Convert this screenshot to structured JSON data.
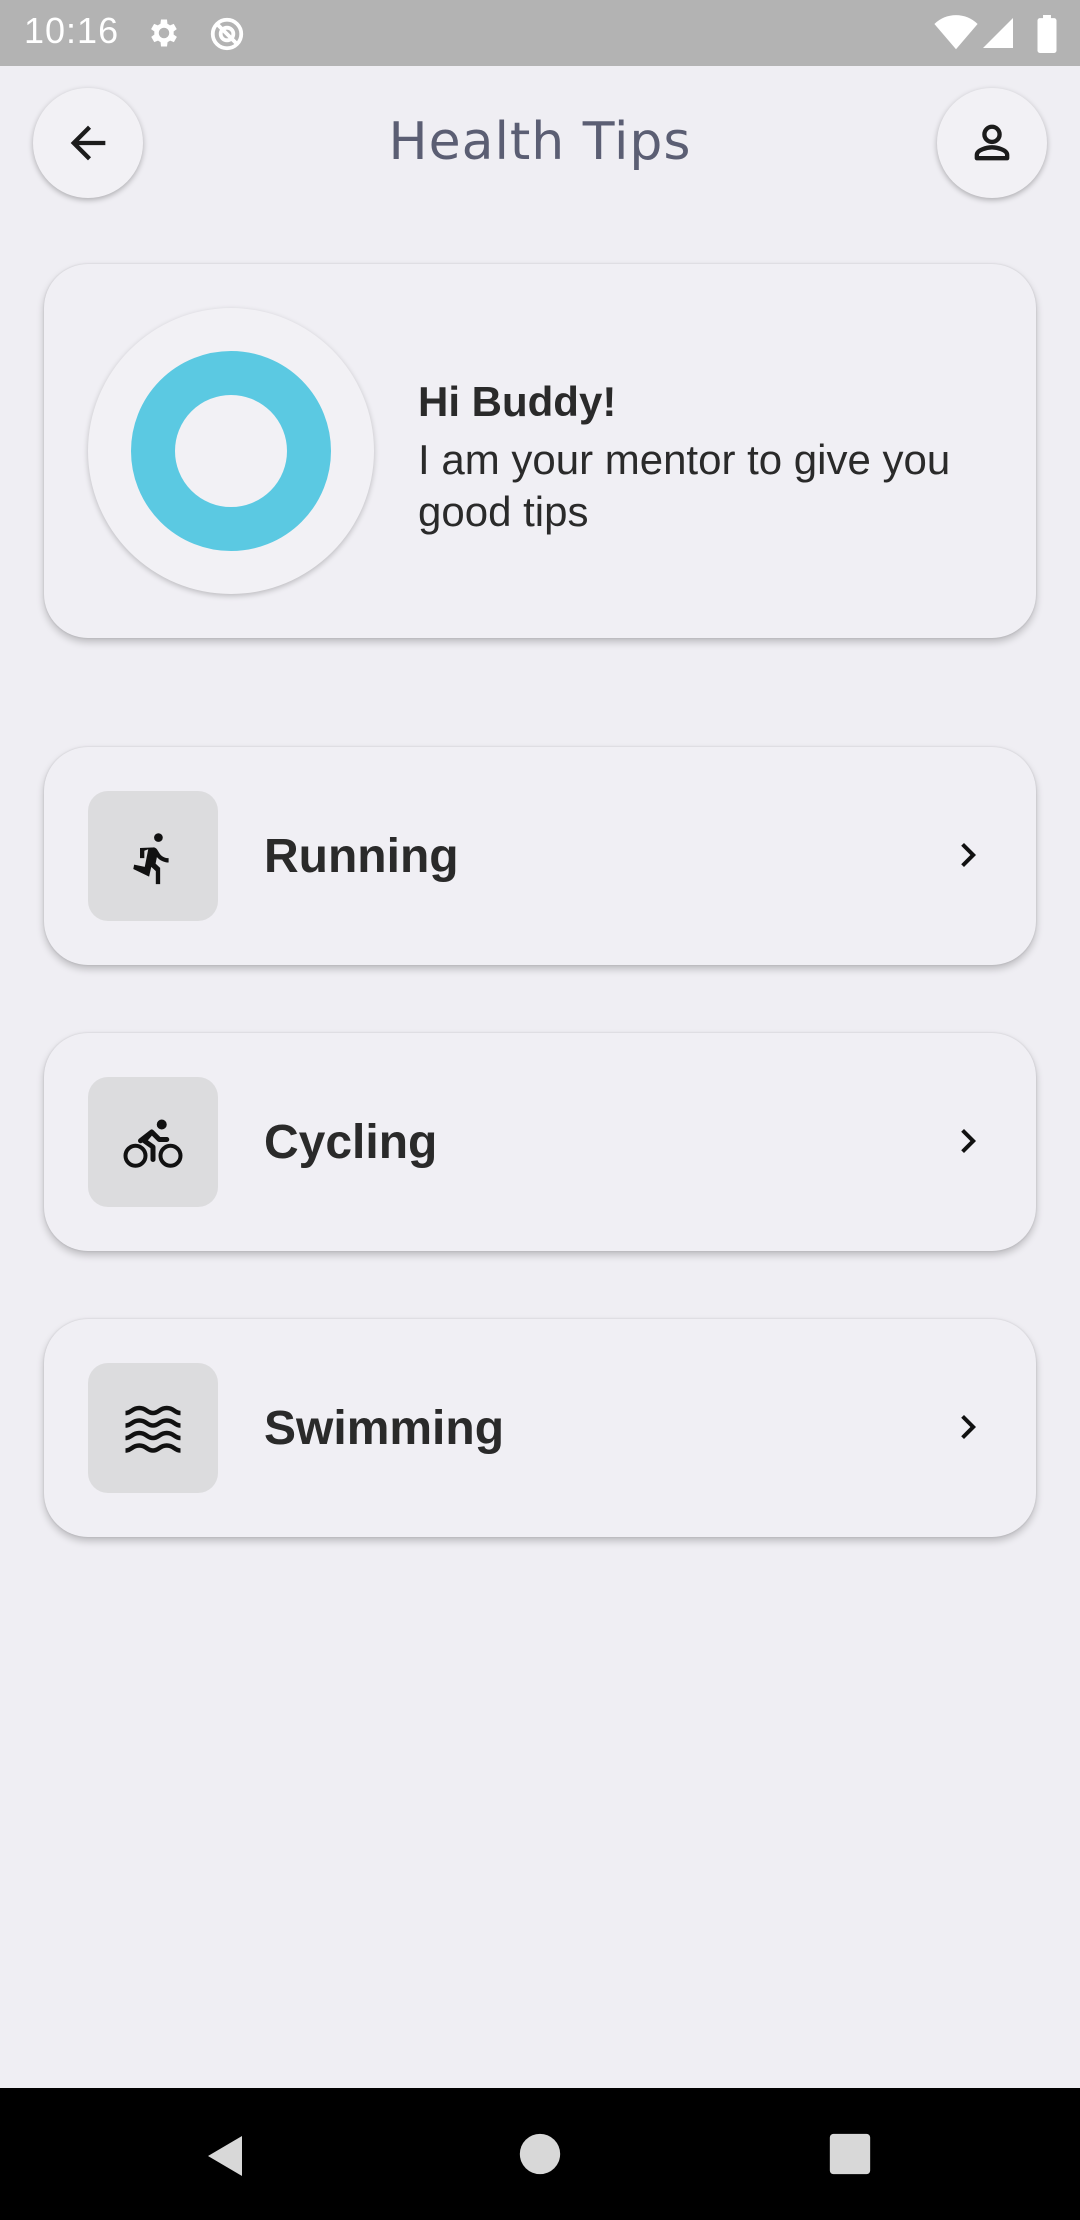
{
  "status_bar": {
    "time": "10:16",
    "icons": [
      "gear-icon",
      "vpn-key-icon",
      "wifi-icon",
      "signal-icon",
      "battery-icon"
    ]
  },
  "header": {
    "title": "Health Tips",
    "back_icon": "arrow-left-icon",
    "profile_icon": "person-icon"
  },
  "mentor": {
    "title": "Hi Buddy!",
    "message": "I am your mentor to give you good tips",
    "ring_color": "#5bc9e2"
  },
  "tips": [
    {
      "label": "Running",
      "icon": "running-icon"
    },
    {
      "label": "Cycling",
      "icon": "cycling-icon"
    },
    {
      "label": "Swimming",
      "icon": "swimming-icon"
    }
  ],
  "nav_bar": {
    "buttons": [
      "back-triangle-icon",
      "home-circle-icon",
      "recents-square-icon"
    ]
  },
  "colors": {
    "background": "#efeef3",
    "accent": "#5bc9e2",
    "status_bar": "#b3b3b3"
  }
}
